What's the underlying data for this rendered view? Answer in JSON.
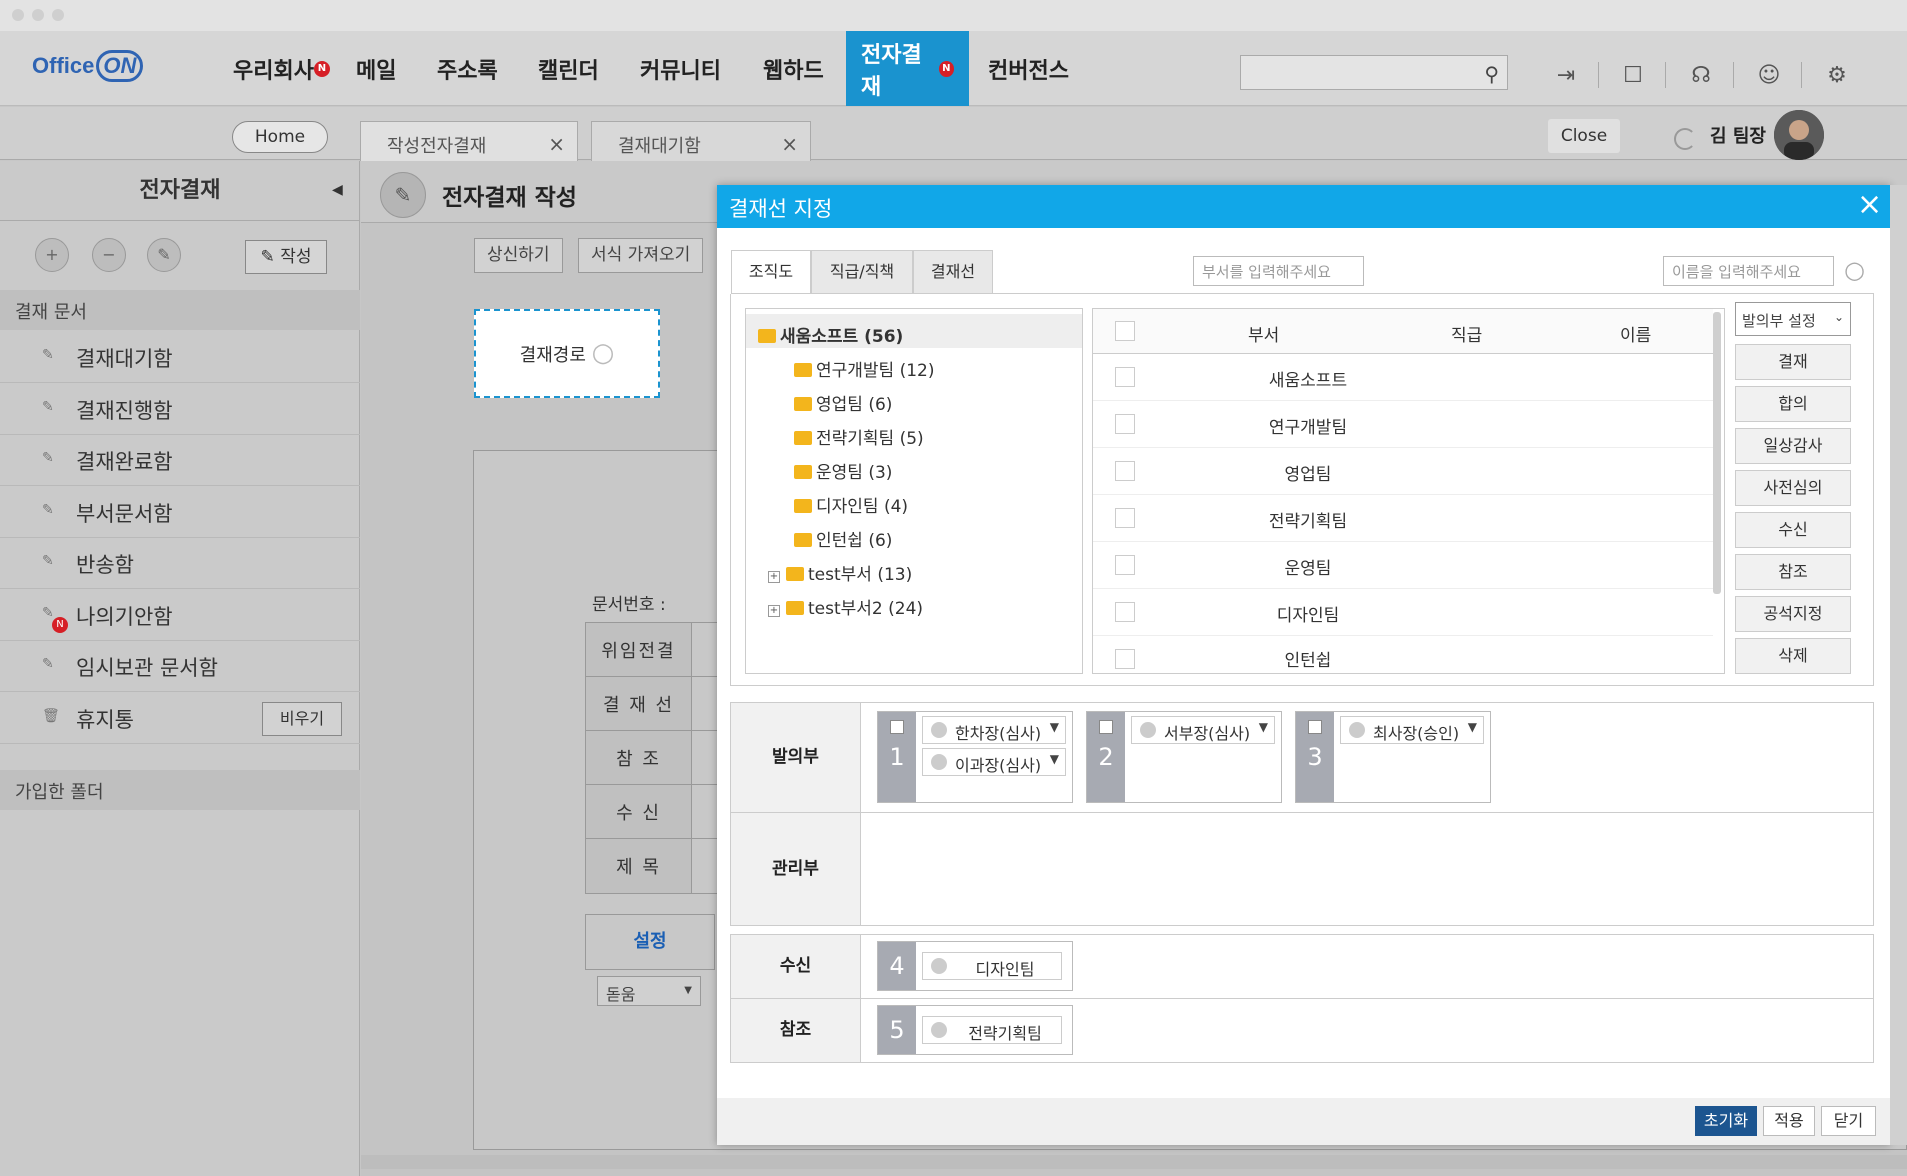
{
  "app": {
    "logo_text": "Office",
    "logo_on": "ON"
  },
  "topmenu": [
    {
      "label": "우리회사",
      "badge": "N"
    },
    {
      "label": "메일"
    },
    {
      "label": "주소록"
    },
    {
      "label": "캘린더"
    },
    {
      "label": "커뮤니티"
    },
    {
      "label": "웹하드"
    },
    {
      "label": "전자결재",
      "badge": "N",
      "active": true
    },
    {
      "label": "컨버전스"
    }
  ],
  "tabs": [
    {
      "label": "Home"
    },
    {
      "label": "작성전자결재",
      "close": "×"
    },
    {
      "label": "결재대기함",
      "close": "×"
    }
  ],
  "close_label": "Close",
  "user": {
    "name": "김 팀장"
  },
  "sidebar": {
    "title": "전자결재",
    "write_label": "작성",
    "section1": "결재 문서",
    "items": [
      {
        "label": "결재대기함"
      },
      {
        "label": "결재진행함"
      },
      {
        "label": "결재완료함"
      },
      {
        "label": "부서문서함"
      },
      {
        "label": "반송함"
      },
      {
        "label": "나의기안함",
        "badge": "N"
      },
      {
        "label": "임시보관 문서함"
      },
      {
        "label": "휴지통"
      }
    ],
    "empty_label": "비우기",
    "section2": "가입한 폴더"
  },
  "content": {
    "title": "전자결재 작성",
    "actions": [
      "상신하기",
      "서식 가져오기"
    ],
    "route_label": "결재경로",
    "docno_label": "문서번호 :",
    "form_rows": [
      "위임전결",
      "결 재 선",
      "참  조",
      "수  신",
      "제  목"
    ],
    "setting_label": "설정",
    "select_value": "돋움"
  },
  "modal": {
    "title": "결재선 지정",
    "close": "×",
    "tabs": [
      "조직도",
      "직급/직책",
      "결재선"
    ],
    "dept_placeholder": "부서를 입력해주세요",
    "name_placeholder": "이름을 입력해주세요",
    "tree": [
      {
        "label": "새움소프트 (56)",
        "root": true
      },
      {
        "label": "연구개발팀 (12)"
      },
      {
        "label": "영업팀 (6)"
      },
      {
        "label": "전략기획팀 (5)"
      },
      {
        "label": "운영팀 (3)"
      },
      {
        "label": "디자인팀 (4)"
      },
      {
        "label": "인턴쉽 (6)"
      },
      {
        "label": "test부서 (13)",
        "expand": "+"
      },
      {
        "label": "test부서2 (24)",
        "expand": "+"
      }
    ],
    "grid_headers": [
      "부서",
      "직급",
      "이름"
    ],
    "grid_rows": [
      "새움소프트",
      "연구개발팀",
      "영업팀",
      "전략기획팀",
      "운영팀",
      "디자인팀",
      "인턴쉽"
    ],
    "role_select": "발의부 설정",
    "role_buttons": [
      "결재",
      "합의",
      "일상감사",
      "사전심의",
      "수신",
      "참조",
      "공석지정",
      "삭제"
    ],
    "lanes": {
      "balui": "발의부",
      "gwanri": "관리부",
      "susin": "수신",
      "chamjo": "참조"
    },
    "slots": [
      {
        "num": "1",
        "chips": [
          "한차장(심사)",
          "이과장(심사)"
        ]
      },
      {
        "num": "2",
        "chips": [
          "서부장(심사)"
        ]
      },
      {
        "num": "3",
        "chips": [
          "최사장(승인)"
        ]
      }
    ],
    "susin_slot": {
      "num": "4",
      "chip": "디자인팀"
    },
    "chamjo_slot": {
      "num": "5",
      "chip": "전략기획팀"
    },
    "footer": [
      "초기화",
      "적용",
      "닫기"
    ]
  },
  "colors": {
    "accent": "#11a7e8",
    "nav_active": "#1a93cf",
    "badge": "#d61f26",
    "primary_btn": "#1c5590"
  }
}
